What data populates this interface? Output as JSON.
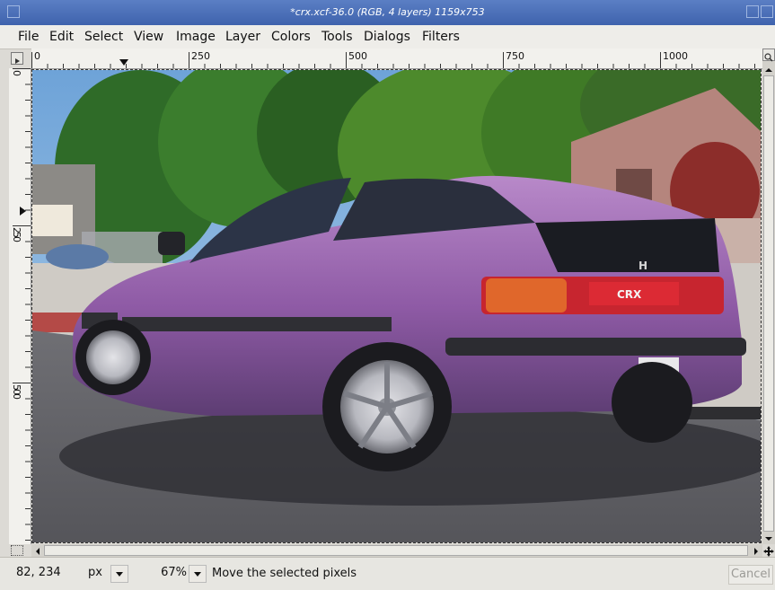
{
  "window": {
    "title": "*crx.xcf-36.0 (RGB, 4 layers) 1159x753"
  },
  "menu": {
    "items": [
      {
        "label": "File"
      },
      {
        "label": "Edit"
      },
      {
        "label": "Select"
      },
      {
        "label": "View"
      },
      {
        "label": "Image"
      },
      {
        "label": "Layer"
      },
      {
        "label": "Colors"
      },
      {
        "label": "Tools"
      },
      {
        "label": "Dialogs"
      },
      {
        "label": "Filters"
      }
    ]
  },
  "rulers": {
    "horizontal_labels": [
      "0",
      "250",
      "500",
      "750",
      "1000"
    ],
    "vertical_labels": [
      "0",
      "250",
      "500"
    ]
  },
  "canvas": {
    "emblem": "H",
    "badge": "CRX"
  },
  "status": {
    "coordinates": "82, 234",
    "unit": "px",
    "zoom": "67%",
    "message": "Move the selected pixels",
    "cancel_label": "Cancel"
  },
  "icons": {
    "menu_button": "menu-icon",
    "zoom": "zoom-icon",
    "quick_mask": "quick-mask-icon",
    "navigate": "navigate-icon"
  }
}
